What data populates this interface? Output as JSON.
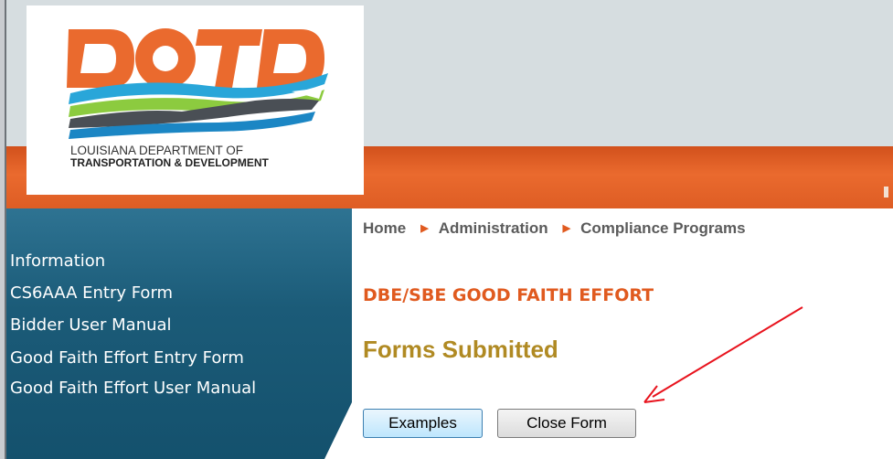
{
  "logo": {
    "wordmark": "DOTD",
    "line1": "LOUISIANA DEPARTMENT OF",
    "line2": "TRANSPORTATION & DEVELOPMENT"
  },
  "breadcrumb": {
    "items": [
      "Home",
      "Administration",
      "Compliance Programs"
    ]
  },
  "sidebar": {
    "items": [
      {
        "label": "Information"
      },
      {
        "label": "CS6AAA Entry Form"
      },
      {
        "label": "Bidder User Manual"
      },
      {
        "label": "Good Faith Effort Entry Form"
      },
      {
        "label": "Good Faith Effort User Manual"
      }
    ]
  },
  "main": {
    "section_heading": "DBE/SBE GOOD FAITH EFFORT",
    "title": "Forms Submitted",
    "buttons": {
      "examples": "Examples",
      "close_form": "Close Form"
    }
  },
  "annotation": {
    "arrow_color": "#e8131d",
    "points_to": "close-form-button"
  },
  "colors": {
    "brand_orange": "#e05a1f",
    "sidebar_blue": "#1b5b78",
    "title_gold": "#b08a23",
    "banner_grey": "#d6dde0"
  }
}
